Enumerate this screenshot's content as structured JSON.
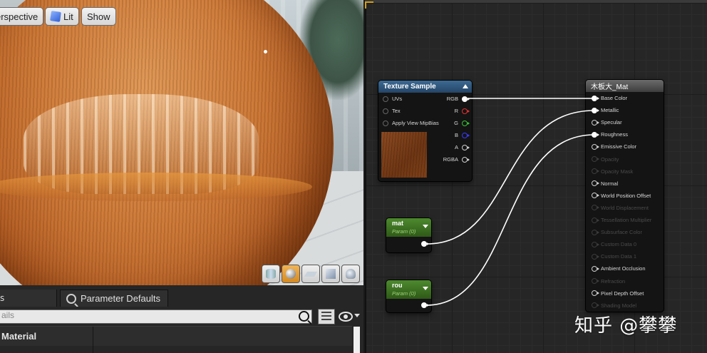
{
  "viewport": {
    "buttons": {
      "perspective": "erspective",
      "lit": "Lit",
      "show": "Show"
    },
    "tool_icons": [
      "cylinder-icon",
      "sphere-icon",
      "plane-icon",
      "cube-icon",
      "teapot-icon"
    ],
    "active_tool": "sphere-icon"
  },
  "bottom_panel": {
    "tab_partial": "s",
    "tab_param_defaults": "Parameter Defaults",
    "search_placeholder": "ails",
    "material_row": "Material"
  },
  "graph": {
    "texture_sample": {
      "title": "Texture Sample",
      "inputs": [
        "UVs",
        "Tex",
        "Apply View MipBias"
      ],
      "outputs": [
        "RGB",
        "R",
        "G",
        "B",
        "A",
        "RGBA"
      ]
    },
    "param_mat": {
      "name": "mat",
      "subtitle": "Param (0)"
    },
    "param_rou": {
      "name": "rou",
      "subtitle": "Param (0)"
    },
    "result_node": {
      "title": "木板大_Mat",
      "inputs": [
        {
          "label": "Base Color",
          "state": "connected"
        },
        {
          "label": "Metallic",
          "state": "connected"
        },
        {
          "label": "Specular",
          "state": "open"
        },
        {
          "label": "Roughness",
          "state": "connected"
        },
        {
          "label": "Emissive Color",
          "state": "open"
        },
        {
          "label": "Opacity",
          "state": "disabled"
        },
        {
          "label": "Opacity Mask",
          "state": "disabled"
        },
        {
          "label": "Normal",
          "state": "open"
        },
        {
          "label": "World Position Offset",
          "state": "open"
        },
        {
          "label": "World Displacement",
          "state": "disabled"
        },
        {
          "label": "Tessellation Multiplier",
          "state": "disabled"
        },
        {
          "label": "Subsurface Color",
          "state": "disabled"
        },
        {
          "label": "Custom Data 0",
          "state": "disabled"
        },
        {
          "label": "Custom Data 1",
          "state": "disabled"
        },
        {
          "label": "Ambient Occlusion",
          "state": "open"
        },
        {
          "label": "Refraction",
          "state": "disabled"
        },
        {
          "label": "Pixel Depth Offset",
          "state": "open"
        },
        {
          "label": "Shading Model",
          "state": "disabled"
        }
      ]
    }
  },
  "watermark": "知乎 @攀攀",
  "colors": {
    "texture_header": "#3d6a94",
    "param_header": "#4d8a2e",
    "result_header": "#6b6b6b",
    "wire": "#ffffff"
  }
}
